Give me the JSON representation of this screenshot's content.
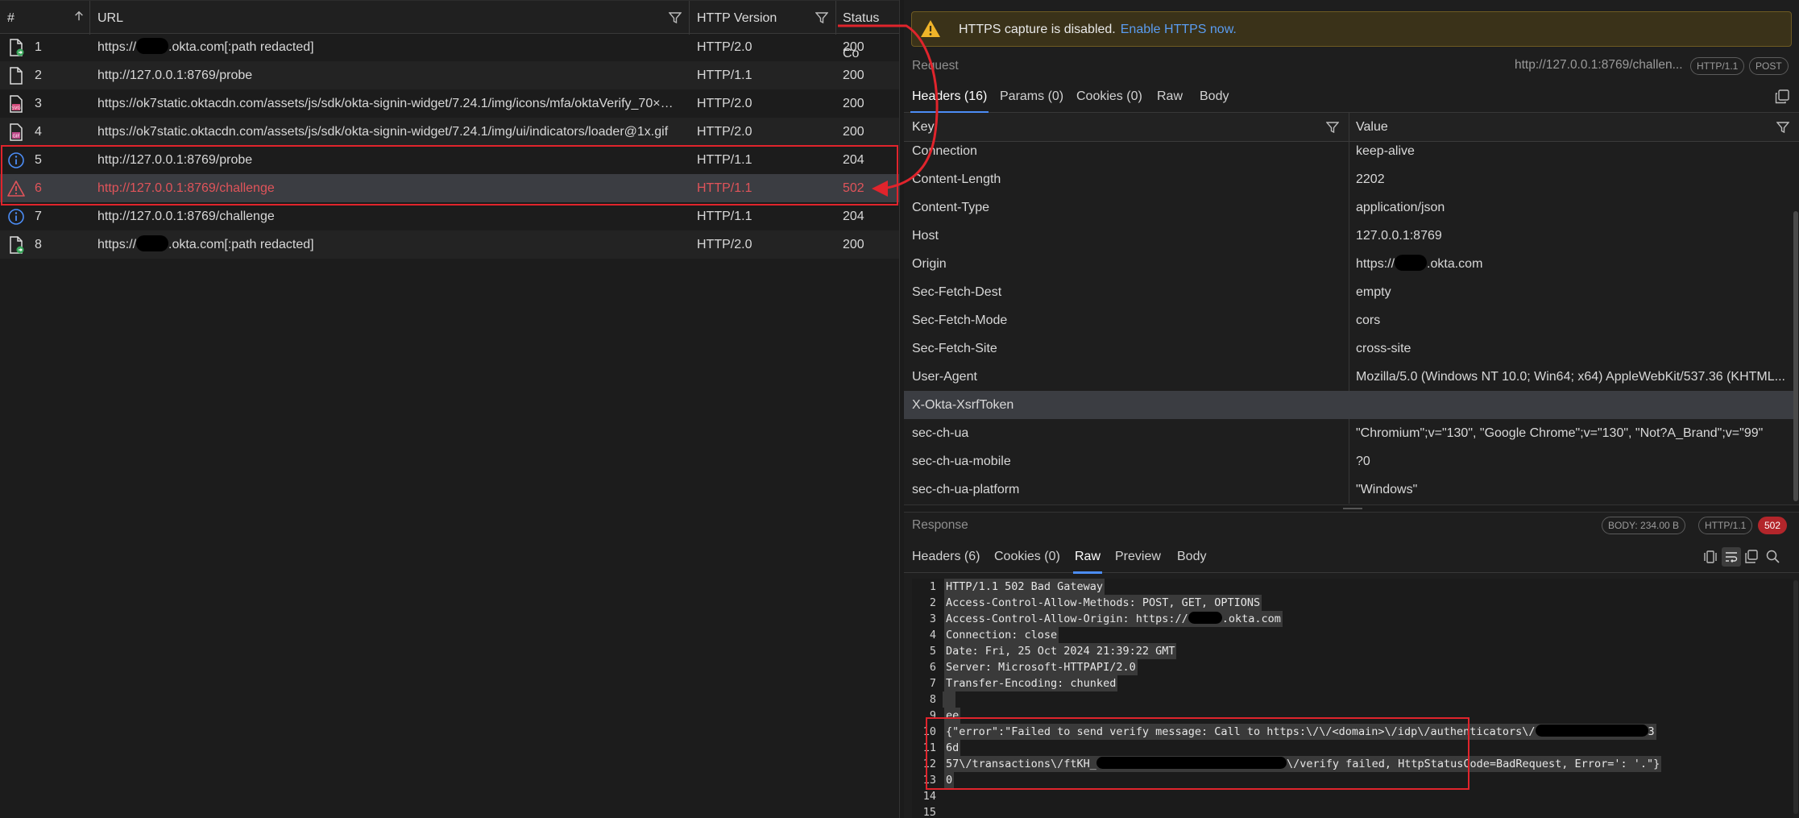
{
  "table": {
    "columns": [
      {
        "label": "#"
      },
      {
        "label": "URL"
      },
      {
        "label": "HTTP Version"
      },
      {
        "label": "Status Co"
      }
    ],
    "rows": [
      {
        "num": "1",
        "icon": "document-out-icon",
        "url_prefix": "https://",
        "url_suffix": ".okta.com[:path redacted]",
        "version": "HTTP/2.0",
        "status": "200"
      },
      {
        "num": "2",
        "icon": "document-icon",
        "url": "http://127.0.0.1:8769/probe",
        "version": "HTTP/1.1",
        "status": "200"
      },
      {
        "num": "3",
        "icon": "svg-file-icon",
        "url": "https://ok7static.oktacdn.com/assets/js/sdk/okta-signin-widget/7.24.1/img/icons/mfa/oktaVerify_70×…",
        "version": "HTTP/2.0",
        "status": "200"
      },
      {
        "num": "4",
        "icon": "gif-file-icon",
        "url": "https://ok7static.oktacdn.com/assets/js/sdk/okta-signin-widget/7.24.1/img/ui/indicators/loader@1x.gif",
        "version": "HTTP/2.0",
        "status": "200"
      },
      {
        "num": "5",
        "icon": "info-icon",
        "url": "http://127.0.0.1:8769/probe",
        "version": "HTTP/1.1",
        "status": "204"
      },
      {
        "num": "6",
        "icon": "warning-icon",
        "url": "http://127.0.0.1:8769/challenge",
        "version": "HTTP/1.1",
        "status": "502"
      },
      {
        "num": "7",
        "icon": "info-icon",
        "url": "http://127.0.0.1:8769/challenge",
        "version": "HTTP/1.1",
        "status": "204"
      },
      {
        "num": "8",
        "icon": "document-out-icon",
        "url_prefix": "https://",
        "url_suffix": ".okta.com[:path redacted]",
        "version": "HTTP/2.0",
        "status": "200"
      }
    ]
  },
  "banner": {
    "text": "HTTPS capture is disabled.",
    "link": "Enable HTTPS now."
  },
  "request": {
    "title": "Request",
    "url": "http://127.0.0.1:8769/challen...",
    "version_pill": "HTTP/1.1",
    "method_pill": "POST",
    "tabs": [
      "Headers (16)",
      "Params (0)",
      "Cookies (0)",
      "Raw",
      "Body"
    ],
    "active_tab": "Headers (16)",
    "col_key": "Key",
    "col_value": "Value",
    "headers": [
      {
        "k": "Connection",
        "v": "keep-alive"
      },
      {
        "k": "Content-Length",
        "v": "2202"
      },
      {
        "k": "Content-Type",
        "v": "application/json"
      },
      {
        "k": "Host",
        "v": "127.0.0.1:8769"
      },
      {
        "k": "Origin",
        "v_prefix": "https://",
        "v_suffix": ".okta.com"
      },
      {
        "k": "Sec-Fetch-Dest",
        "v": "empty"
      },
      {
        "k": "Sec-Fetch-Mode",
        "v": "cors"
      },
      {
        "k": "Sec-Fetch-Site",
        "v": "cross-site"
      },
      {
        "k": "User-Agent",
        "v": "Mozilla/5.0 (Windows NT 10.0; Win64; x64) AppleWebKit/537.36 (KHTML..."
      },
      {
        "k": "X-Okta-XsrfToken",
        "v": ""
      },
      {
        "k": "sec-ch-ua",
        "v": "\"Chromium\";v=\"130\", \"Google Chrome\";v=\"130\", \"Not?A_Brand\";v=\"99\""
      },
      {
        "k": "sec-ch-ua-mobile",
        "v": "?0"
      },
      {
        "k": "sec-ch-ua-platform",
        "v": "\"Windows\""
      }
    ]
  },
  "response": {
    "title": "Response",
    "body_pill": "BODY: 234.00 B",
    "version_pill": "HTTP/1.1",
    "status_pill": "502",
    "tabs": [
      "Headers (6)",
      "Cookies (0)",
      "Raw",
      "Preview",
      "Body"
    ],
    "active_tab": "Raw",
    "raw_lines": [
      {
        "n": "1",
        "t": "HTTP/1.1 502 Bad Gateway"
      },
      {
        "n": "2",
        "t": "Access-Control-Allow-Methods: POST, GET, OPTIONS"
      },
      {
        "n": "3",
        "t_a": "Access-Control-Allow-Origin: https://",
        "t_b": ".okta.com"
      },
      {
        "n": "4",
        "t": "Connection: close"
      },
      {
        "n": "5",
        "t": "Date: Fri, 25 Oct 2024 21:39:22 GMT"
      },
      {
        "n": "6",
        "t": "Server: Microsoft-HTTPAPI/2.0"
      },
      {
        "n": "7",
        "t": "Transfer-Encoding: chunked"
      },
      {
        "n": "8",
        "t": ""
      },
      {
        "n": "9",
        "t": "ee"
      },
      {
        "n": "10",
        "t_a": "{\"error\":\"Failed to send verify message: Call to https:\\/\\/<domain>\\/idp\\/authenticators\\/",
        "t_b": "3"
      },
      {
        "n": "11",
        "t": "6d"
      },
      {
        "n": "12",
        "t_a": "57\\/transactions\\/ftKH_",
        "t_b": "\\/verify failed, HttpStatusCode=BadRequest, Error=': '.\"}"
      },
      {
        "n": "13",
        "t": "0"
      },
      {
        "n": "14",
        "t": ""
      },
      {
        "n": "15",
        "t": ""
      }
    ]
  },
  "colors": {
    "accent": "#4c8df6",
    "error": "#e0545a",
    "annotation": "#e0242c",
    "warning": "#f0b429"
  }
}
